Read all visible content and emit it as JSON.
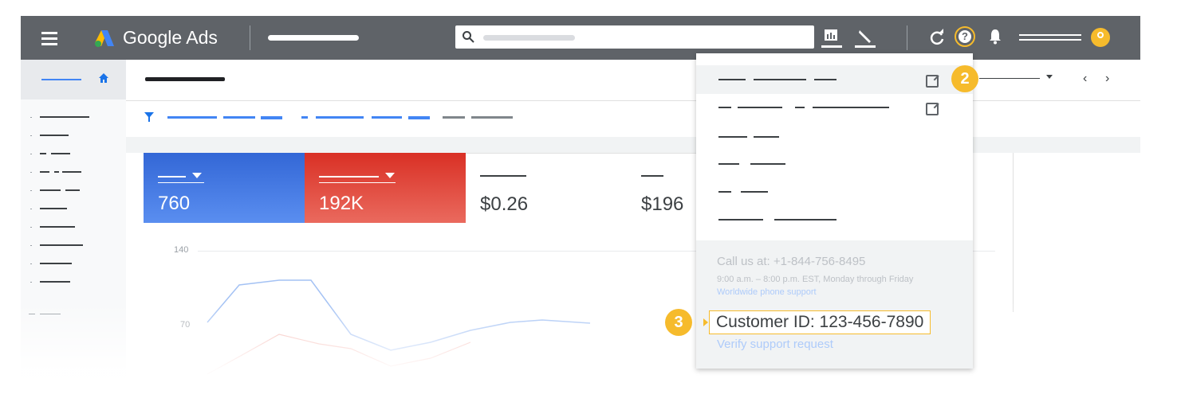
{
  "topbar": {
    "brand": "Google Ads",
    "icons": [
      "menu-icon",
      "google-ads-logo",
      "search-icon",
      "reports-icon",
      "tools-icon",
      "refresh-icon",
      "help-icon",
      "notifications-icon",
      "account-avatar"
    ]
  },
  "metrics": [
    {
      "value": "760",
      "color": "#3367d6"
    },
    {
      "value": "192K",
      "color": "#d93025"
    },
    {
      "value": "$0.26"
    },
    {
      "value": "$196"
    }
  ],
  "chart": {
    "ticks": [
      "140",
      "70"
    ]
  },
  "help_menu": {
    "call_text": "Call us at: +1-844-756-8495",
    "hours_text": "9:00 a.m. – 8:00 p.m. EST, Monday through Friday",
    "worldwide_link": "Worldwide phone support",
    "customer_id": "Customer ID: 123-456-7890",
    "verify_link": "Verify support request"
  },
  "callouts": {
    "help": "2",
    "customer_id": "3"
  },
  "colors": {
    "callout": "#f6bb2c",
    "topbar": "#5f6368",
    "link": "#4285f4"
  }
}
